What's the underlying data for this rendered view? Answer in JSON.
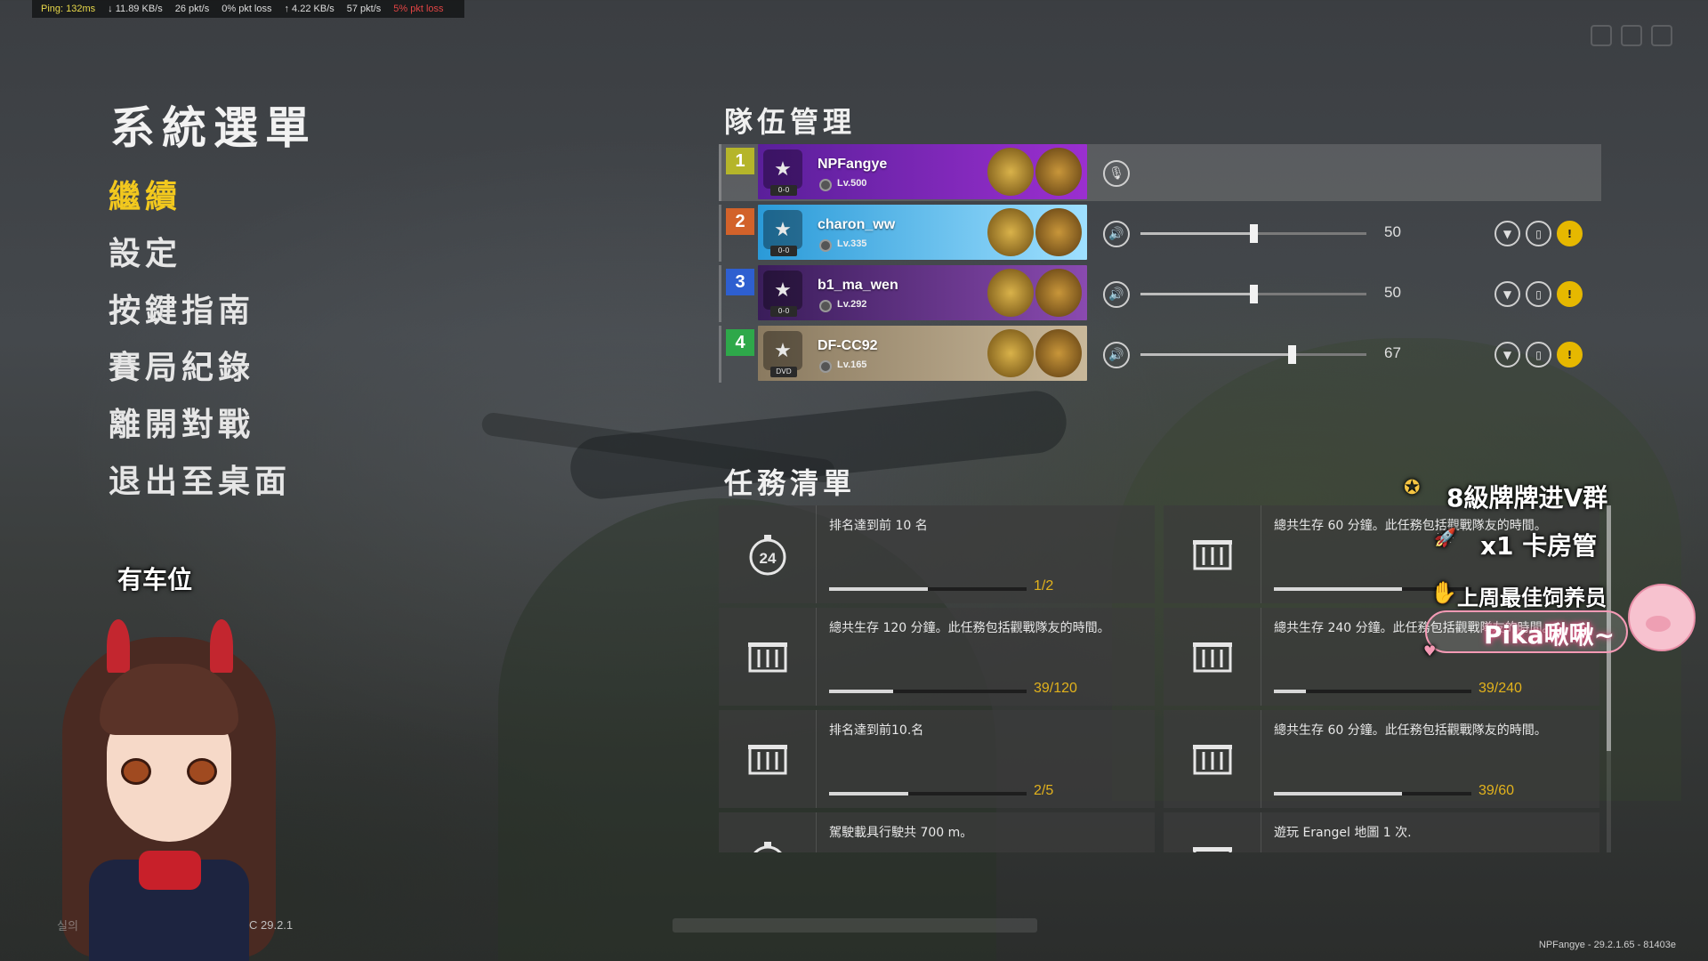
{
  "netstats": {
    "ping": "Ping: 132ms",
    "down_rate": "↓ 11.89 KB/s",
    "down_pkts": "26 pkt/s",
    "down_loss": "0% pkt loss",
    "up_rate": "↑ 4.22 KB/s",
    "up_pkts": "57 pkt/s",
    "up_loss": "5% pkt loss"
  },
  "menu": {
    "title": "系統選單",
    "items": [
      "繼續",
      "設定",
      "按鍵指南",
      "賽局紀錄",
      "離開對戰",
      "退出至桌面"
    ],
    "active_index": 0
  },
  "team": {
    "title": "隊伍管理",
    "players": [
      {
        "slot": "1",
        "slot_color": "#b5b52a",
        "name": "NPFangye",
        "level": "Lv.500",
        "rank": "0-0",
        "nameplate_colors": [
          "#5a1f9a",
          "#9b2fd0"
        ],
        "self": true
      },
      {
        "slot": "2",
        "slot_color": "#d2622a",
        "name": "charon_ww",
        "level": "Lv.335",
        "rank": "0-0",
        "nameplate_colors": [
          "#2a9ad8",
          "#9fe0ff"
        ],
        "volume": 50
      },
      {
        "slot": "3",
        "slot_color": "#2e5fd0",
        "name": "b1_ma_wen",
        "level": "Lv.292",
        "rank": "0-0",
        "nameplate_colors": [
          "#3a1d5a",
          "#8a4ab0"
        ],
        "volume": 50
      },
      {
        "slot": "4",
        "slot_color": "#2ea84a",
        "name": "DF-CC92",
        "level": "Lv.165",
        "rank": "DVD",
        "nameplate_colors": [
          "#8a7a60",
          "#c9b89a"
        ],
        "volume": 67
      }
    ]
  },
  "missions": {
    "title": "任務清單",
    "items": [
      {
        "text": "排名達到前 10 名",
        "icon": "timer-24-icon",
        "progress": "1/2",
        "fraction": 0.5
      },
      {
        "text": "總共生存 60 分鐘。此任務包括觀戰隊友的時間。",
        "icon": "crate-icon",
        "progress": "",
        "fraction": 0.65
      },
      {
        "text": "總共生存 120 分鐘。此任務包括觀戰隊友的時間。",
        "icon": "crate-icon",
        "progress": "39/120",
        "fraction": 0.325
      },
      {
        "text": "總共生存 240 分鐘。此任務包括觀戰隊友的時間。",
        "icon": "crate-icon",
        "progress": "39/240",
        "fraction": 0.1625
      },
      {
        "text": "排名達到前10.名",
        "icon": "crate-icon",
        "progress": "2/5",
        "fraction": 0.4
      },
      {
        "text": "總共生存 60 分鐘。此任務包括觀戰隊友的時間。",
        "icon": "crate-icon",
        "progress": "39/60",
        "fraction": 0.65
      },
      {
        "text": "駕駛載具行駛共 700 m。",
        "icon": "timer-icon",
        "progress": "",
        "fraction": 0
      },
      {
        "text": "遊玩 Erangel 地圖 1 次.",
        "icon": "crate-icon",
        "progress": "",
        "fraction": 0
      }
    ]
  },
  "overlay": {
    "seat_text": "有车位",
    "group_text": "8級牌牌进V群",
    "manager_text": "x1 卡房管",
    "weekly_text": "上周最佳饲养员",
    "pika_text": "Pika啾啾~",
    "version_left": "C 29.2.1",
    "version_left_faint": "실의"
  },
  "version": "NPFangye - 29.2.1.65 - 81403e"
}
